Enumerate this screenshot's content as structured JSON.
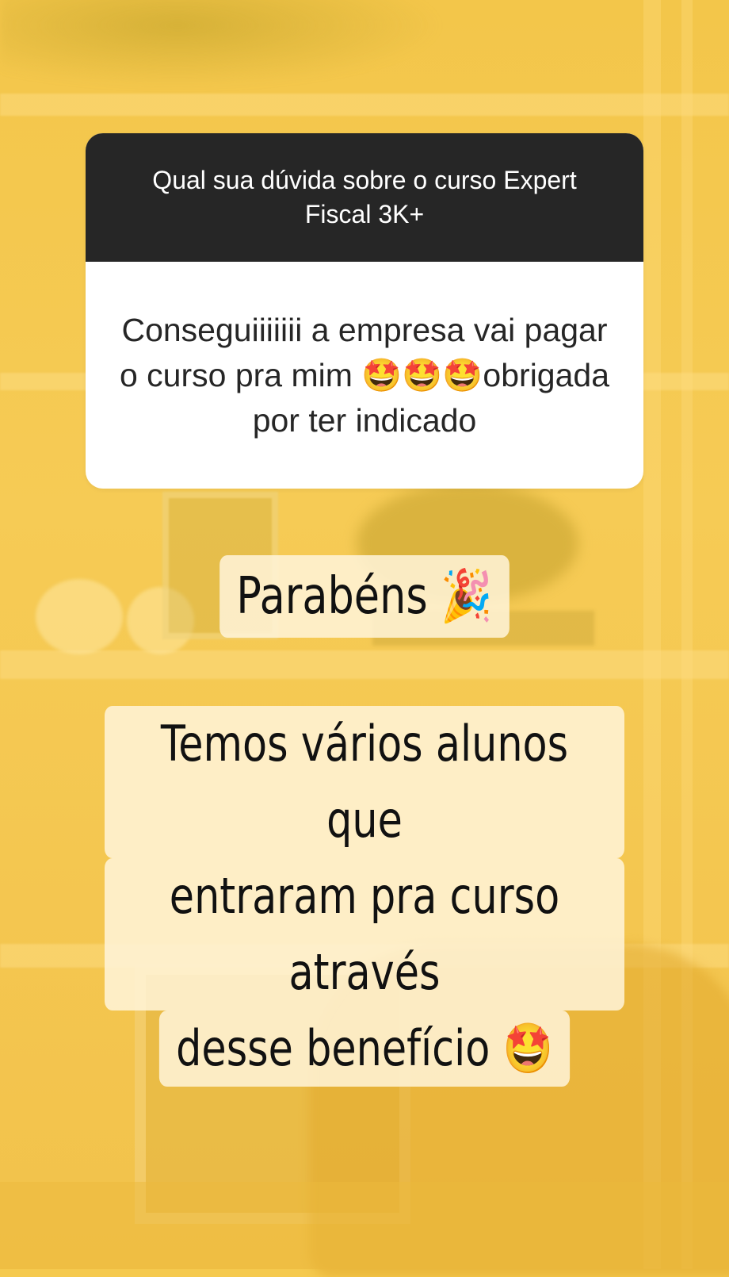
{
  "question_sticker": {
    "prompt": "Qual sua dúvida sobre o curso Expert Fiscal 3K+",
    "answer": "Conseguiiiiiii a empresa vai pagar o curso pra mim 🤩🤩🤩obrigada por ter indicado"
  },
  "captions": {
    "first": "Parabéns 🎉",
    "second_lines": [
      "Temos vários alunos que",
      "entraram pra curso através",
      "desse benefício 🤩"
    ]
  },
  "colors": {
    "background": "#f5c94e",
    "sticker_header": "#262626",
    "sticker_body": "#ffffff",
    "caption_highlight": "#fff4da"
  }
}
